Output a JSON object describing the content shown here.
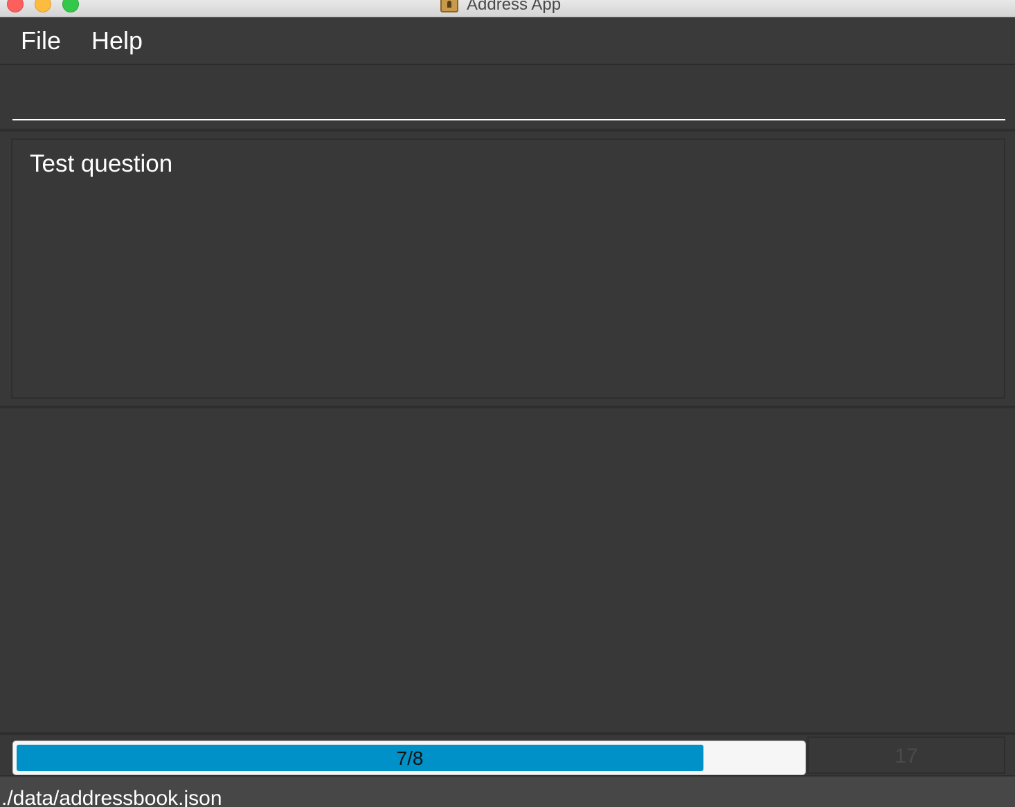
{
  "window": {
    "title": "Address App",
    "controls": [
      "close",
      "minimize",
      "maximize"
    ],
    "icon": "address-book-icon"
  },
  "menu": {
    "items": [
      {
        "label": "File"
      },
      {
        "label": "Help"
      }
    ]
  },
  "command": {
    "value": "",
    "placeholder": ""
  },
  "result": {
    "text": "Test question"
  },
  "progress": {
    "label": "7/8",
    "fraction": 0.875,
    "count": "17",
    "fill_color": "#0091c9"
  },
  "status": {
    "path": "./data/addressbook.json"
  }
}
